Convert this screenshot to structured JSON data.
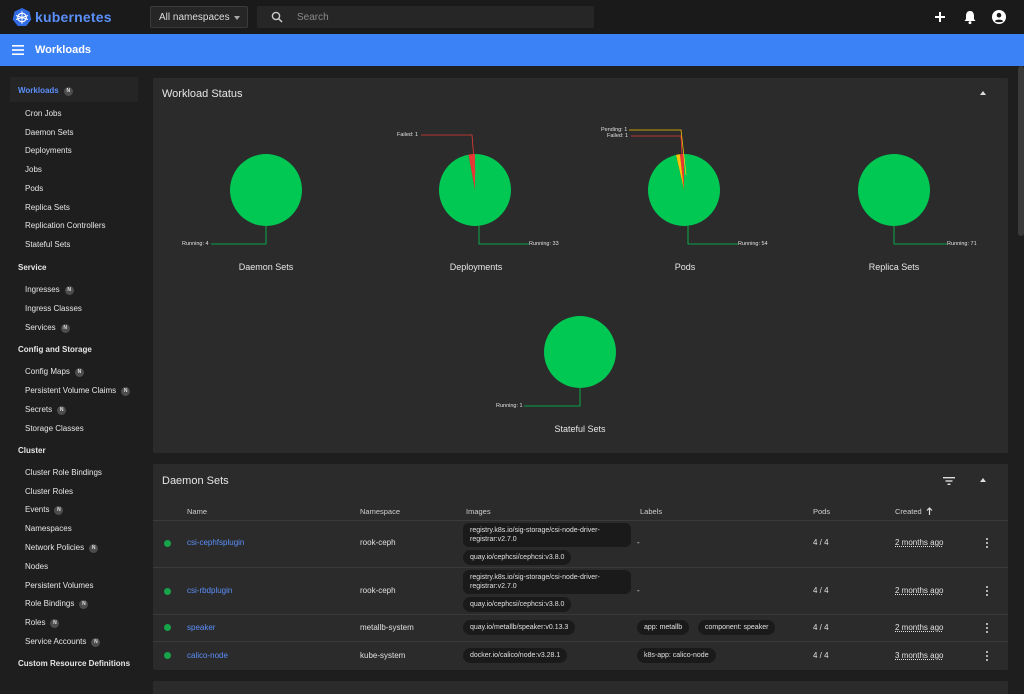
{
  "app": {
    "brand": "kubernetes"
  },
  "topbar": {
    "namespace_select": "All namespaces",
    "search_placeholder": "Search"
  },
  "titlebar": {
    "title": "Workloads"
  },
  "sidebar": {
    "workloads": {
      "label": "Workloads",
      "badge": "N"
    },
    "workload_items": [
      "Cron Jobs",
      "Daemon Sets",
      "Deployments",
      "Jobs",
      "Pods",
      "Replica Sets",
      "Replication Controllers",
      "Stateful Sets"
    ],
    "service": {
      "label": "Service"
    },
    "service_items": [
      {
        "label": "Ingresses",
        "badge": "N"
      },
      {
        "label": "Ingress Classes",
        "badge": ""
      },
      {
        "label": "Services",
        "badge": "N"
      }
    ],
    "config": {
      "label": "Config and Storage"
    },
    "config_items": [
      {
        "label": "Config Maps",
        "badge": "N"
      },
      {
        "label": "Persistent Volume Claims",
        "badge": "N"
      },
      {
        "label": "Secrets",
        "badge": "N"
      },
      {
        "label": "Storage Classes",
        "badge": ""
      }
    ],
    "cluster": {
      "label": "Cluster"
    },
    "cluster_items": [
      {
        "label": "Cluster Role Bindings",
        "badge": ""
      },
      {
        "label": "Cluster Roles",
        "badge": ""
      },
      {
        "label": "Events",
        "badge": "N"
      },
      {
        "label": "Namespaces",
        "badge": ""
      },
      {
        "label": "Network Policies",
        "badge": "N"
      },
      {
        "label": "Nodes",
        "badge": ""
      },
      {
        "label": "Persistent Volumes",
        "badge": ""
      },
      {
        "label": "Role Bindings",
        "badge": "N"
      },
      {
        "label": "Roles",
        "badge": "N"
      },
      {
        "label": "Service Accounts",
        "badge": "N"
      }
    ],
    "crd": {
      "label": "Custom Resource Definitions"
    }
  },
  "workload_status": {
    "title": "Workload Status",
    "charts": [
      {
        "title": "Daemon Sets",
        "running": "Running: 4"
      },
      {
        "title": "Deployments",
        "running": "Running: 33",
        "failed": "Failed: 1"
      },
      {
        "title": "Pods",
        "running": "Running: 54",
        "pending": "Pending: 1",
        "failed": "Failed: 1"
      },
      {
        "title": "Replica Sets",
        "running": "Running: 71"
      },
      {
        "title": "Stateful Sets",
        "running": "Running: 1"
      }
    ]
  },
  "chart_data": [
    {
      "type": "pie",
      "title": "Daemon Sets",
      "categories": [
        "Running"
      ],
      "values": [
        4
      ]
    },
    {
      "type": "pie",
      "title": "Deployments",
      "categories": [
        "Running",
        "Failed"
      ],
      "values": [
        33,
        1
      ]
    },
    {
      "type": "pie",
      "title": "Pods",
      "categories": [
        "Running",
        "Pending",
        "Failed"
      ],
      "values": [
        54,
        1,
        1
      ]
    },
    {
      "type": "pie",
      "title": "Replica Sets",
      "categories": [
        "Running"
      ],
      "values": [
        71
      ]
    },
    {
      "type": "pie",
      "title": "Stateful Sets",
      "categories": [
        "Running"
      ],
      "values": [
        1
      ]
    }
  ],
  "colors": {
    "running": "#00c853",
    "failed": "#e53935",
    "pending": "#ffc107",
    "accent": "#3c82f7"
  },
  "daemon_sets": {
    "title": "Daemon Sets",
    "columns": {
      "name": "Name",
      "namespace": "Namespace",
      "images": "Images",
      "labels": "Labels",
      "pods": "Pods",
      "created": "Created"
    },
    "rows": [
      {
        "name": "csi-cephfsplugin",
        "namespace": "rook-ceph",
        "images": [
          "registry.k8s.io/sig-storage/csi-node-driver-registrar:v2.7.0",
          "quay.io/cephcsi/cephcsi:v3.8.0"
        ],
        "labels": "-",
        "pods": "4 / 4",
        "created": "2 months ago"
      },
      {
        "name": "csi-rbdplugin",
        "namespace": "rook-ceph",
        "images": [
          "registry.k8s.io/sig-storage/csi-node-driver-registrar:v2.7.0",
          "quay.io/cephcsi/cephcsi:v3.8.0"
        ],
        "labels": "-",
        "pods": "4 / 4",
        "created": "2 months ago"
      },
      {
        "name": "speaker",
        "namespace": "metallb-system",
        "images": [
          "quay.io/metallb/speaker:v0.13.3"
        ],
        "labels": [
          "app: metallb",
          "component: speaker"
        ],
        "pods": "4 / 4",
        "created": "2 months ago"
      },
      {
        "name": "calico-node",
        "namespace": "kube-system",
        "images": [
          "docker.io/calico/node:v3.28.1"
        ],
        "labels": [
          "k8s-app: calico-node"
        ],
        "pods": "4 / 4",
        "created": "3 months ago"
      }
    ]
  }
}
